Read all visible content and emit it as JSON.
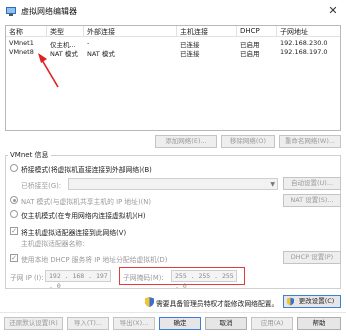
{
  "window": {
    "title": "虚拟网络编辑器",
    "close_glyph": "✕"
  },
  "table": {
    "columns": [
      "名称",
      "类型",
      "外部连接",
      "主机连接",
      "DHCP",
      "子网地址"
    ],
    "rows": [
      {
        "name": "VMnet1",
        "type": "仅主机...",
        "external": "-",
        "host": "已连接",
        "dhcp": "已启用",
        "subnet": "192.168.230.0"
      },
      {
        "name": "VMnet8",
        "type": "NAT 模式",
        "external": "NAT 模式",
        "host": "已连接",
        "dhcp": "已启用",
        "subnet": "192.168.197.0"
      }
    ]
  },
  "table_buttons": {
    "add": "添加网络(E)...",
    "remove": "移除网络(O)",
    "rename": "重命名网络(W)..."
  },
  "vmnet_info": {
    "label": "VMnet 信息",
    "bridged_label": "桥接模式(将虚拟机直接连接到外部网络)(B)",
    "bridged_to_label": "已桥接至(G):",
    "bridged_to_value": "",
    "auto_settings": "自动设置(U)...",
    "nat_label": "NAT 模式(与虚拟机共享主机的 IP 地址)(N)",
    "nat_settings": "NAT 设置(S)...",
    "hostonly_label": "仅主机模式(在专用网络内连接虚拟机)(H)",
    "connect_adapter_label": "将主机虚拟适配器连接到此网络(V)",
    "adapter_name_label": "主机虚拟适配器名称:",
    "dhcp_label": "使用本地 DHCP 服务将 IP 地址分配给虚拟机(D)",
    "dhcp_settings": "DHCP 设置(P)",
    "subnet_ip_label": "子网 IP (I):",
    "subnet_ip_value": "192 . 168 . 197 .  0",
    "subnet_mask_label": "子网掩码(M):",
    "subnet_mask_value": "255 . 255 . 255 .  0"
  },
  "admin_notice": "需要具备管理员特权才能修改网络配置。",
  "change_settings": "更改设置(C)",
  "bottom_buttons": {
    "restore": "还原默认设置(R)",
    "import": "导入(T)...",
    "export": "导出(X)...",
    "ok": "确定",
    "cancel": "取消",
    "apply": "应用(A)",
    "help": "帮助"
  },
  "colors": {
    "accent_blue": "#3c7fd4",
    "highlight_red": "#e23b3b",
    "arrow_red": "#e02020"
  }
}
